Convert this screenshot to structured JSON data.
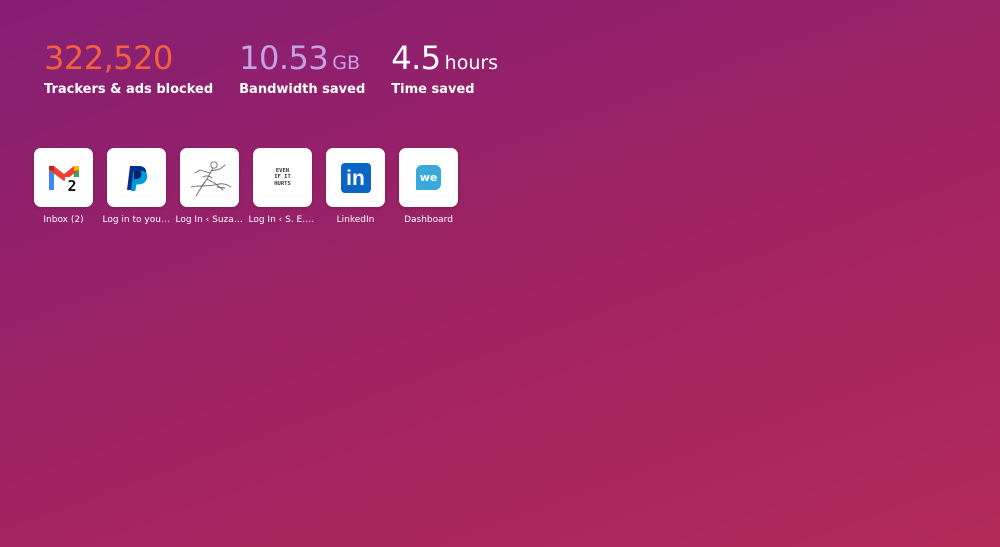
{
  "stats": [
    {
      "value": "322,520",
      "unit": "",
      "label": "Trackers & ads blocked",
      "color": "#f2603e"
    },
    {
      "value": "10.53",
      "unit": "GB",
      "label": "Bandwidth saved",
      "color": "#c4a0e6"
    },
    {
      "value": "4.5",
      "unit": "hours",
      "label": "Time saved",
      "color": "#ffffff"
    }
  ],
  "shortcuts": [
    {
      "label": "Inbox (2)",
      "icon": "gmail-icon",
      "badge": "2"
    },
    {
      "label": "Log in to your PayPal account",
      "icon": "paypal-icon"
    },
    {
      "label": "Log In ‹ Suzanne",
      "icon": "sketch-figure-icon"
    },
    {
      "label": "Log In ‹ S. E. Hinton",
      "icon": "even-if-it-hurts-icon",
      "icon_text": [
        "EVEN",
        "IF IT",
        "HURTS"
      ]
    },
    {
      "label": "LinkedIn",
      "icon": "linkedin-icon",
      "icon_text": "in"
    },
    {
      "label": "Dashboard",
      "icon": "we-icon",
      "icon_text": "we"
    }
  ],
  "colors": {
    "linkedin": "#0a66c2",
    "paypal_dark": "#003087",
    "paypal_light": "#009cde",
    "we": "#39a9dc"
  }
}
